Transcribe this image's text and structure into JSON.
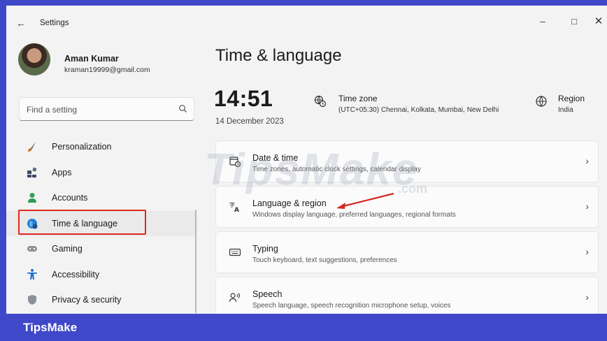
{
  "titlebar": {
    "title": "Settings",
    "back_icon": "back-arrow-icon",
    "minimize": "–",
    "maximize": "□",
    "close": "✕"
  },
  "profile": {
    "name": "Aman Kumar",
    "email": "kraman19999@gmail.com"
  },
  "search": {
    "placeholder": "Find a setting",
    "icon": "search-icon"
  },
  "sidebar": {
    "items": [
      {
        "label": "Personalization",
        "icon": "brush-icon",
        "color": "#c56a1a"
      },
      {
        "label": "Apps",
        "icon": "apps-icon",
        "color": "#3b4a63"
      },
      {
        "label": "Accounts",
        "icon": "person-icon",
        "color": "#2f9e5a"
      },
      {
        "label": "Time & language",
        "icon": "globe-clock-icon",
        "color": "#1f7fd1",
        "active": true
      },
      {
        "label": "Gaming",
        "icon": "gamepad-icon",
        "color": "#8a8f98"
      },
      {
        "label": "Accessibility",
        "icon": "accessibility-icon",
        "color": "#1f6fd6"
      },
      {
        "label": "Privacy & security",
        "icon": "shield-icon",
        "color": "#8a8f98"
      }
    ]
  },
  "main": {
    "title": "Time & language",
    "clock": "14:51",
    "date": "14 December 2023",
    "timezone": {
      "title": "Time zone",
      "value": "(UTC+05:30) Chennai, Kolkata, Mumbai, New Delhi"
    },
    "region": {
      "title": "Region",
      "value": "India"
    },
    "cards": [
      {
        "title": "Date & time",
        "subtitle": "Time zones, automatic clock settings, calendar display",
        "icon": "calendar-clock-icon"
      },
      {
        "title": "Language & region",
        "subtitle": "Windows display language, preferred languages, regional formats",
        "icon": "language-icon"
      },
      {
        "title": "Typing",
        "subtitle": "Touch keyboard, text suggestions, preferences",
        "icon": "keyboard-icon"
      },
      {
        "title": "Speech",
        "subtitle": "Speech language, speech recognition microphone setup, voices",
        "icon": "speech-icon"
      }
    ]
  },
  "watermark": {
    "text": "TipsMake",
    "suffix": ".com"
  },
  "footer": {
    "brand": "TipsMake"
  },
  "colors": {
    "frame": "#3f48c9",
    "highlight_box": "#e0281e",
    "annotation_arrow": "#d42a1f"
  }
}
